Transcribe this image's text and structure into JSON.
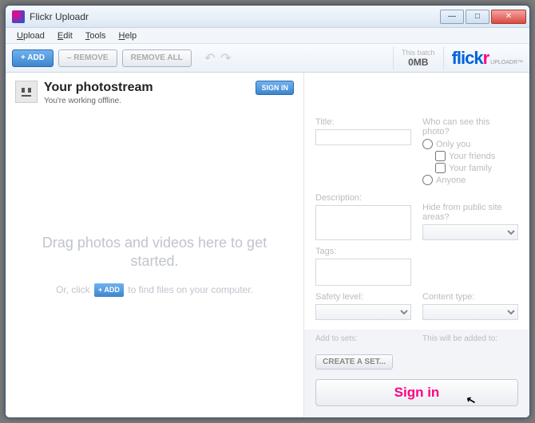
{
  "window": {
    "title": "Flickr Uploadr"
  },
  "menu": {
    "upload": "Upload",
    "edit": "Edit",
    "tools": "Tools",
    "help": "Help"
  },
  "toolbar": {
    "add": "+ ADD",
    "remove": "– REMOVE",
    "remove_all": "REMOVE ALL",
    "batch_label": "This batch",
    "batch_value": "0MB"
  },
  "logo": {
    "part1": "flick",
    "part2": "r",
    "sup": "UPLOADR™"
  },
  "photostream": {
    "title": "Your photostream",
    "subtitle": "You're working offline.",
    "signin": "SIGN IN"
  },
  "dropzone": {
    "line1": "Drag photos and videos here to get started.",
    "line2a": "Or, click",
    "mini_add": "+ ADD",
    "line2b": "to find files on your computer."
  },
  "meta": {
    "title_label": "Title:",
    "description_label": "Description:",
    "tags_label": "Tags:",
    "safety_label": "Safety level:",
    "content_label": "Content type:",
    "addsets_label": "Add to sets:",
    "added_label": "This will be added to:",
    "visibility_label": "Who can see this photo?",
    "only_you": "Only you",
    "your_friends": "Your friends",
    "your_family": "Your family",
    "anyone": "Anyone",
    "hide_label": "Hide from public site areas?"
  },
  "bottom": {
    "create_set": "CREATE A SET...",
    "signin": "Sign in"
  }
}
